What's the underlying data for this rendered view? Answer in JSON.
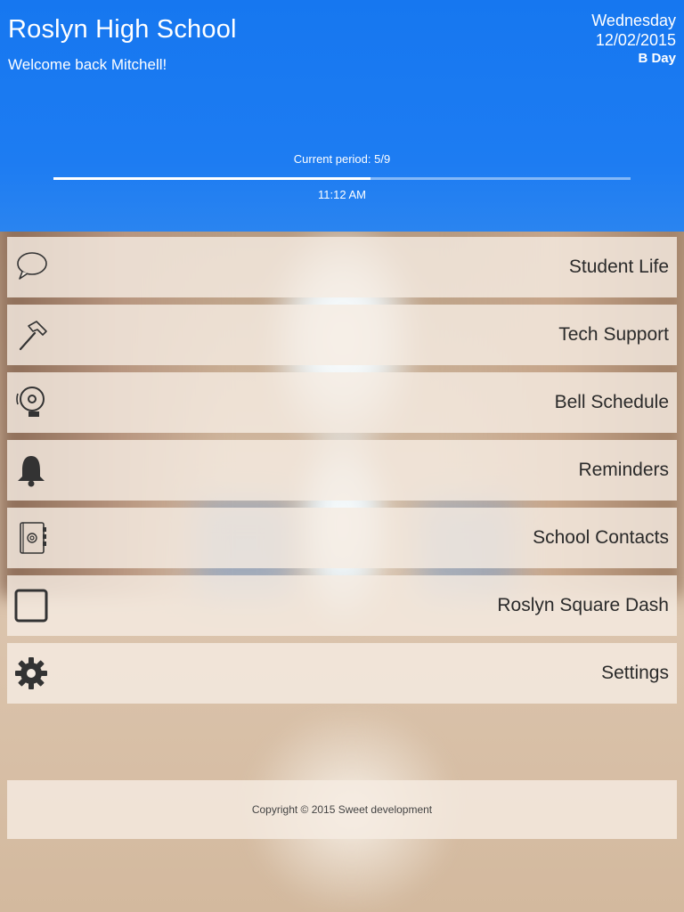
{
  "header": {
    "school_name": "Roslyn High School",
    "welcome": "Welcome back Mitchell!",
    "day_name": "Wednesday",
    "date": "12/02/2015",
    "rotation": "B Day",
    "period_label": "Current period: 5/9",
    "period_progress": 0.55,
    "time": "11:12 AM",
    "accent_color": "#1677f0"
  },
  "menu": {
    "items": [
      {
        "label": "Student Life",
        "icon": "speech-bubble-icon"
      },
      {
        "label": "Tech Support",
        "icon": "hammer-icon"
      },
      {
        "label": "Bell Schedule",
        "icon": "school-bell-icon"
      },
      {
        "label": "Reminders",
        "icon": "bell-icon"
      },
      {
        "label": "School Contacts",
        "icon": "address-book-icon"
      },
      {
        "label": "Roslyn Square Dash",
        "icon": "square-icon"
      },
      {
        "label": "Settings",
        "icon": "gear-icon"
      }
    ]
  },
  "footer": {
    "copyright": "Copyright © 2015 Sweet development"
  }
}
